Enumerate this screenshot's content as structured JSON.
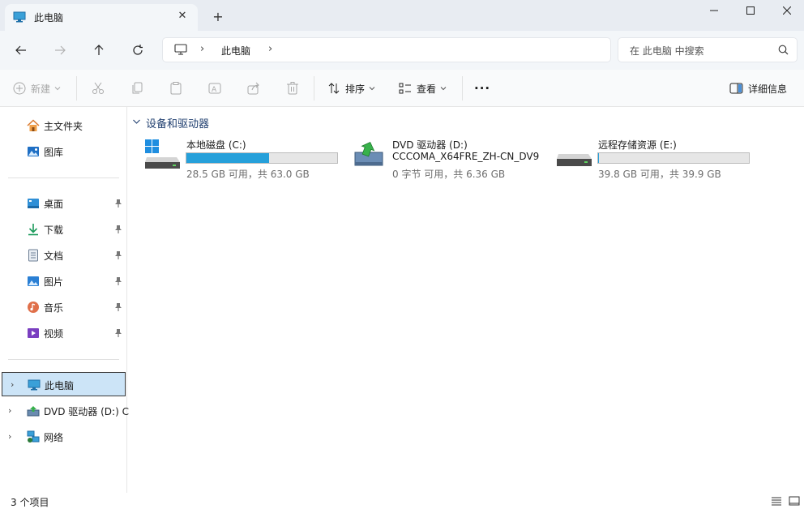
{
  "window": {
    "tab_title": "此电脑",
    "new_tab": "+",
    "close_tab": "✕"
  },
  "navigation": {
    "address_location": "此电脑",
    "search_placeholder": "在 此电脑 中搜索"
  },
  "command_bar": {
    "new_label": "新建",
    "sort_label": "排序",
    "view_label": "查看",
    "more_label": "···",
    "details_label": "详细信息"
  },
  "sidebar": {
    "quick": [
      {
        "label": "主文件夹",
        "icon": "home-icon"
      },
      {
        "label": "图库",
        "icon": "gallery-icon"
      }
    ],
    "pinned": [
      {
        "label": "桌面",
        "icon": "desktop-icon"
      },
      {
        "label": "下载",
        "icon": "download-icon"
      },
      {
        "label": "文档",
        "icon": "documents-icon"
      },
      {
        "label": "图片",
        "icon": "pictures-icon"
      },
      {
        "label": "音乐",
        "icon": "music-icon"
      },
      {
        "label": "视频",
        "icon": "videos-icon"
      }
    ],
    "tree": [
      {
        "label": "此电脑",
        "icon": "this-pc-icon",
        "selected": true
      },
      {
        "label": "DVD 驱动器 (D:) C",
        "icon": "dvd-drive-icon"
      },
      {
        "label": "网络",
        "icon": "network-icon"
      }
    ]
  },
  "content": {
    "group_title": "设备和驱动器",
    "drives": [
      {
        "name": "本地磁盘 (C:)",
        "used_fraction": 0.548,
        "info": "28.5 GB 可用，共 63.0 GB",
        "icon": "windows-drive-icon"
      },
      {
        "name": "DVD 驱动器 (D:)",
        "subtitle": "CCCOMA_X64FRE_ZH-CN_DV9",
        "info": "0 字节 可用，共 6.36 GB",
        "icon": "dvd-drive-icon"
      },
      {
        "name": "远程存储资源 (E:)",
        "used_fraction": 0.003,
        "info": "39.8 GB 可用，共 39.9 GB",
        "icon": "hard-drive-icon"
      }
    ]
  },
  "status": {
    "item_count": "3 个项目"
  },
  "colors": {
    "accent": "#26a0da",
    "selection": "#cce4f7",
    "titlebar": "#e8ecf2"
  }
}
